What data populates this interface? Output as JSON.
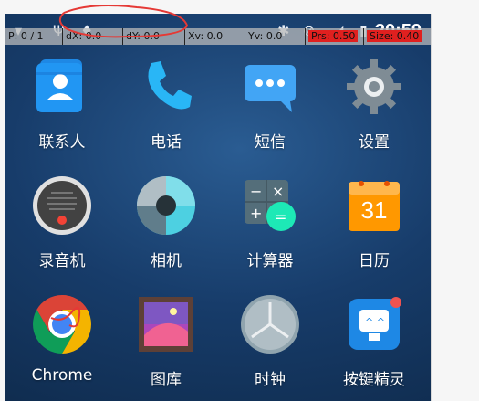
{
  "overlay": {
    "pointer": "P: 0 / 1",
    "dx": "dX: 0.0",
    "dy": "dY: 0.0",
    "xv": "Xv: 0.0",
    "yv": "Yv: 0.0",
    "prs": "Prs: 0.50",
    "size": "Size: 0.40"
  },
  "status": {
    "time": "20:59"
  },
  "apps": [
    {
      "label": "联系人",
      "icon": "contacts-icon"
    },
    {
      "label": "电话",
      "icon": "phone-icon"
    },
    {
      "label": "短信",
      "icon": "messages-icon"
    },
    {
      "label": "设置",
      "icon": "settings-icon"
    },
    {
      "label": "录音机",
      "icon": "recorder-icon"
    },
    {
      "label": "相机",
      "icon": "camera-icon"
    },
    {
      "label": "计算器",
      "icon": "calculator-icon"
    },
    {
      "label": "日历",
      "icon": "calendar-icon",
      "day": "31"
    },
    {
      "label": "Chrome",
      "icon": "chrome-icon"
    },
    {
      "label": "图库",
      "icon": "gallery-icon"
    },
    {
      "label": "时钟",
      "icon": "clock-icon"
    },
    {
      "label": "按键精灵",
      "icon": "keysprite-icon"
    }
  ],
  "colors": {
    "accent_red": "#e0201f",
    "wallpaper": "#1c4576"
  }
}
